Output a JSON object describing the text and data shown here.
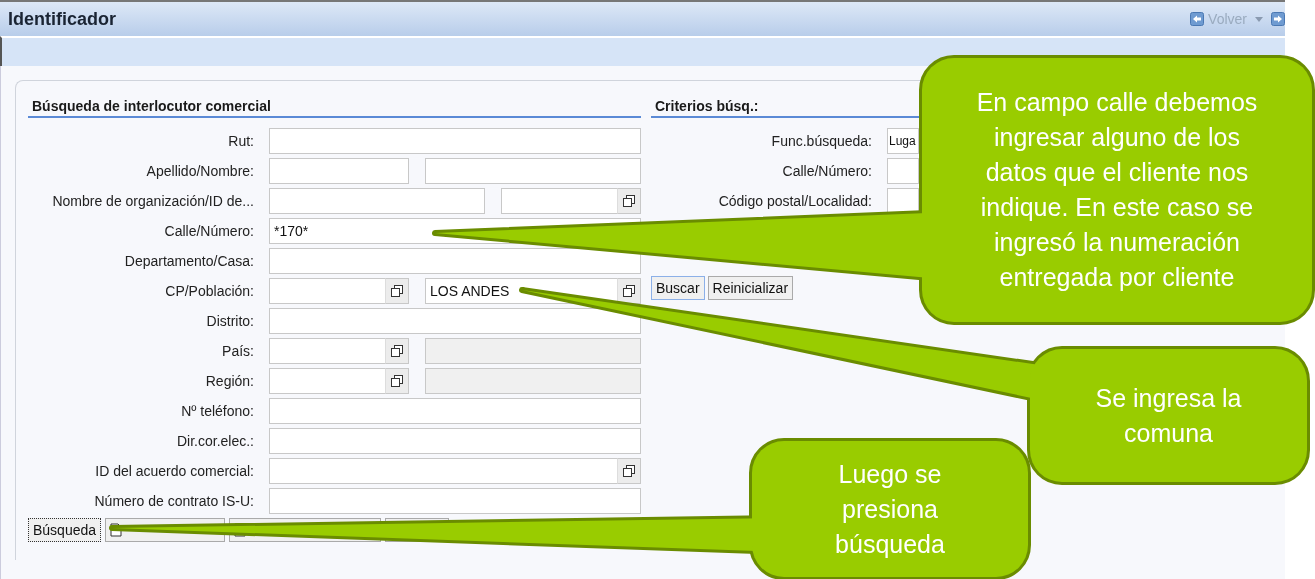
{
  "window": {
    "title": "Identificador",
    "nav": {
      "back_label": "Volver"
    }
  },
  "partner_search": {
    "heading": "Búsqueda de interlocutor comercial",
    "rows": [
      {
        "label": "Rut:",
        "kind": "one",
        "inputs": [
          {
            "kind": "text"
          }
        ]
      },
      {
        "label": "Apellido/Nombre:",
        "kind": "narrow_wide",
        "inputs": [
          {
            "kind": "text"
          },
          {
            "kind": "text"
          }
        ]
      },
      {
        "label": "Nombre de organización/ID de...",
        "kind": "wide_narrow",
        "inputs": [
          {
            "kind": "text"
          },
          {
            "kind": "help"
          }
        ]
      },
      {
        "label": "Calle/Número:",
        "kind": "one",
        "inputs": [
          {
            "kind": "text",
            "value": "*170*"
          }
        ]
      },
      {
        "label": "Departamento/Casa:",
        "kind": "one",
        "inputs": [
          {
            "kind": "text"
          }
        ]
      },
      {
        "label": "CP/Población:",
        "kind": "narrow_wide",
        "inputs": [
          {
            "kind": "help"
          },
          {
            "kind": "help",
            "value": "LOS ANDES"
          }
        ]
      },
      {
        "label": "Distrito:",
        "kind": "one",
        "inputs": [
          {
            "kind": "text"
          }
        ]
      },
      {
        "label": "País:",
        "kind": "narrow_wide",
        "inputs": [
          {
            "kind": "help"
          },
          {
            "kind": "disabled"
          }
        ]
      },
      {
        "label": "Región:",
        "kind": "narrow_wide",
        "inputs": [
          {
            "kind": "help"
          },
          {
            "kind": "disabled"
          }
        ]
      },
      {
        "label": "Nº teléfono:",
        "kind": "one",
        "inputs": [
          {
            "kind": "text"
          }
        ]
      },
      {
        "label": "Dir.cor.elec.:",
        "kind": "one",
        "inputs": [
          {
            "kind": "text"
          }
        ]
      },
      {
        "label": "ID del acuerdo comercial:",
        "kind": "one",
        "inputs": [
          {
            "kind": "help"
          }
        ]
      },
      {
        "label": "Número de contrato IS-U:",
        "kind": "one",
        "inputs": [
          {
            "kind": "text"
          }
        ]
      }
    ],
    "buttons": [
      {
        "kind": "button",
        "label": "Búsqueda"
      },
      {
        "kind": "icon_button"
      },
      {
        "kind": "icon_button"
      },
      {
        "kind": "blank"
      }
    ]
  },
  "criteria": {
    "heading": "Criterios búsq.:",
    "rows": [
      {
        "label": "Func.búsqueda:",
        "value": "Luga"
      },
      {
        "label": "Calle/Número:"
      },
      {
        "label": "Código postal/Localidad:"
      }
    ],
    "buttons": [
      {
        "label": "Buscar",
        "focused": true
      },
      {
        "label": "Reinicializar",
        "focused": false
      }
    ]
  },
  "callouts": [
    {
      "text": "En campo calle debemos ingresar alguno de los datos que el cliente nos indique. En este caso se ingresó la numeración entregada por cliente"
    },
    {
      "text": "Se ingresa la comuna"
    },
    {
      "text": "Luego se presiona búsqueda"
    }
  ]
}
